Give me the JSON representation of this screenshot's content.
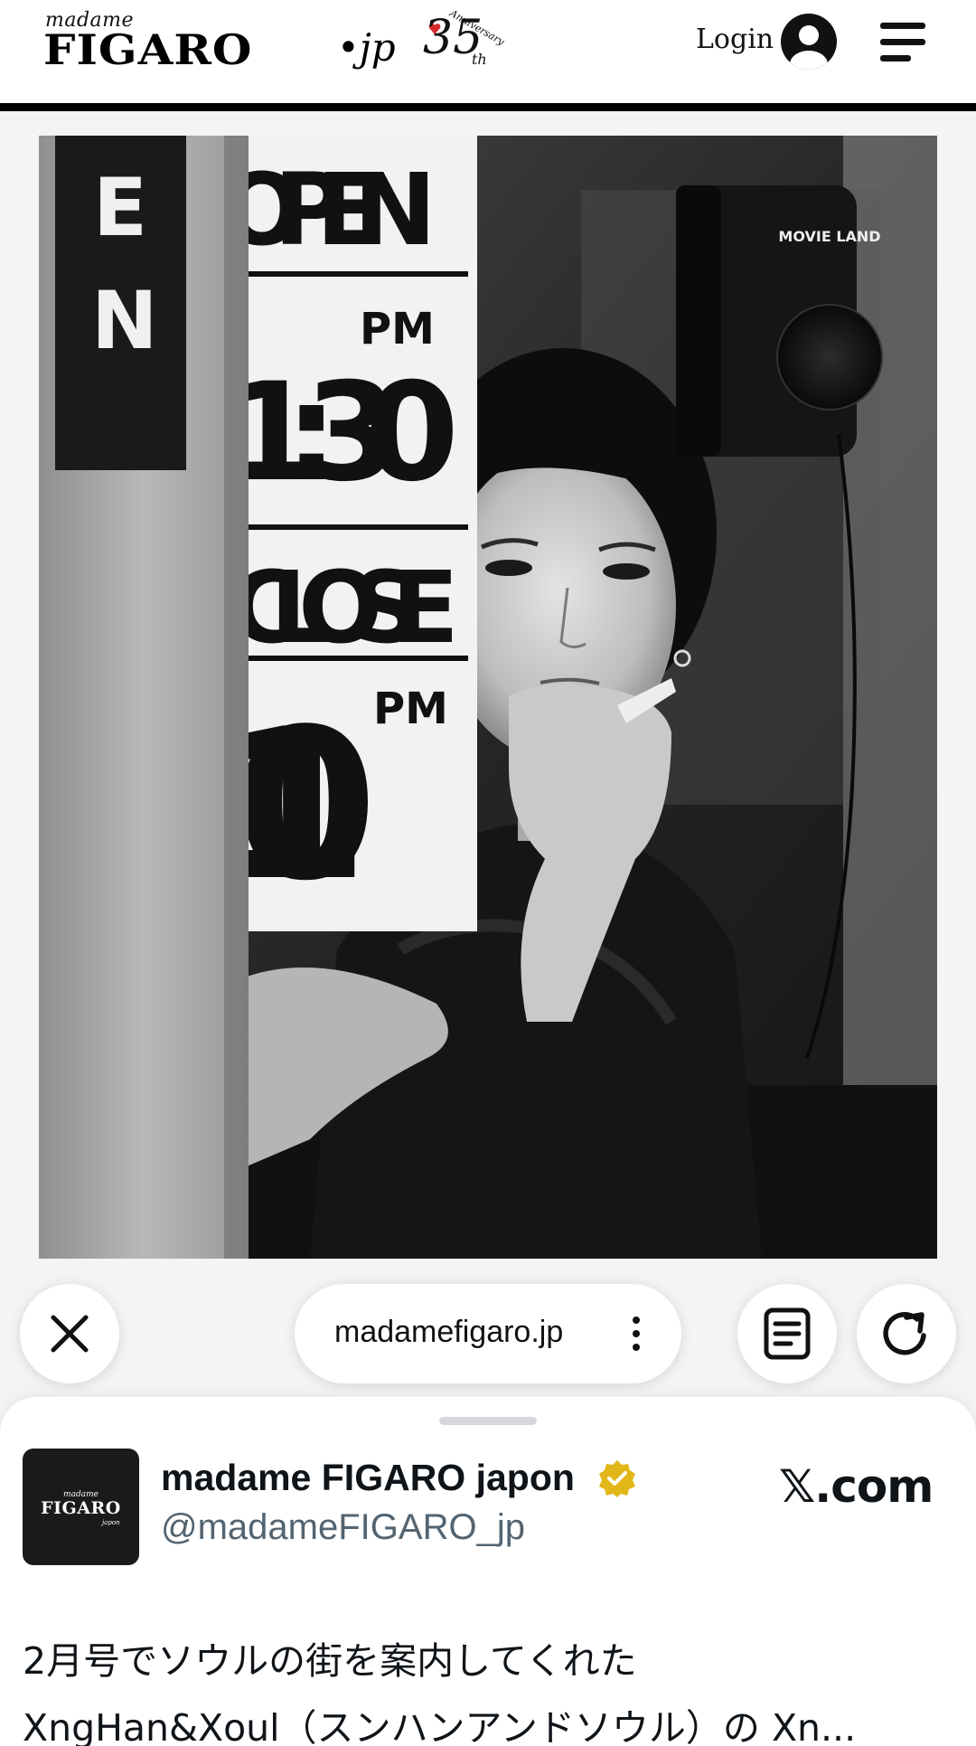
{
  "header": {
    "logo_madame": "madame",
    "logo_figaro": "FIGARO",
    "logo_jp": "•jp",
    "anniversary_number": "35",
    "anniversary_suffix": "th",
    "anniversary_word": "Anniversary",
    "login_label": "Login",
    "icons": {
      "account": "user-circle-icon",
      "menu": "hamburger-menu-icon"
    }
  },
  "hero": {
    "photo_subject": "black-and-white portrait behind shop window",
    "sign_open": "OPEN",
    "sign_open_time": "1:30",
    "sign_pm": "PM",
    "sign_close": "CLOSE",
    "sign_close_time": "10",
    "side_sign": "EN",
    "speaker_label": "MOVIE LAND"
  },
  "browser_bar": {
    "url": "madamefigaro.jp",
    "icons": {
      "close": "close-icon",
      "more": "more-vertical-icon",
      "reader": "reader-mode-icon",
      "reload": "reload-icon"
    }
  },
  "tweet_card": {
    "account_name": "madame FIGARO japon",
    "handle": "@madameFIGARO_jp",
    "source": "𝕏.com",
    "avatar_text": {
      "madame": "madame",
      "figaro": "FIGARO",
      "jp": "japon"
    },
    "text_line1": "2月号でソウルの街を案内してくれた",
    "text_line2": "XngHan&Xoul（スンハンアンドソウル）の Xn...",
    "icons": {
      "verified": "verified-badge-icon"
    }
  },
  "colors": {
    "header_bg": "#ffffff",
    "rule": "#000000",
    "verified": "#e2b719",
    "handle": "#536471",
    "text": "#0f1419"
  }
}
